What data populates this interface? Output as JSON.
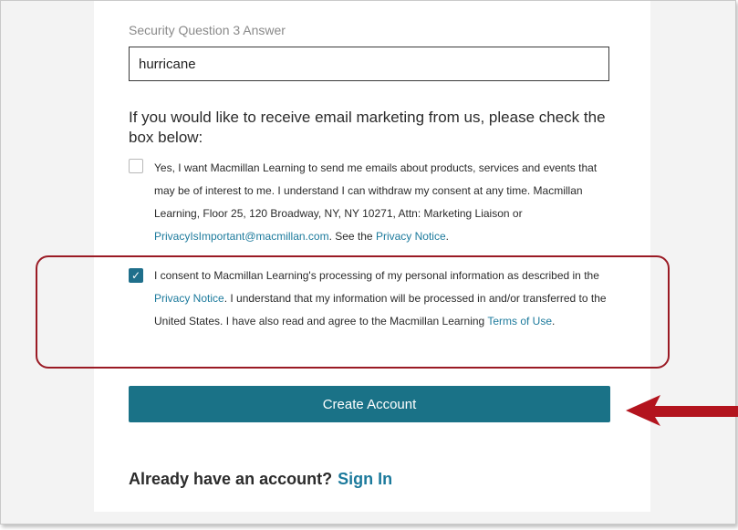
{
  "security": {
    "label": "Security Question 3 Answer",
    "answer_value": "hurricane"
  },
  "marketing": {
    "heading": "If you would like to receive email marketing from us, please check the box below:",
    "checked": false,
    "text_before": "Yes, I want Macmillan Learning to send me emails about products, services and events that may be of interest to me. I understand I can withdraw my consent at any time. Macmillan Learning, Floor 25, 120 Broadway, NY, NY 10271, Attn: Marketing Liaison or ",
    "email_link": "PrivacyIsImportant@macmillan.com",
    "text_mid": ". See the ",
    "privacy_link": "Privacy Notice",
    "text_end": "."
  },
  "consent": {
    "checked": true,
    "check_glyph": "✓",
    "text_before": "I consent to Macmillan Learning's processing of my personal information as described in the ",
    "privacy_link": "Privacy Notice",
    "text_mid": ". I understand that my information will be processed in and/or transferred to the United States. I have also read and agree to the Macmillan Learning ",
    "terms_link": "Terms of Use",
    "text_end": "."
  },
  "create_button_label": "Create Account",
  "signin": {
    "prompt": "Already have an account?",
    "link": "Sign In"
  },
  "colors": {
    "button": "#1a7287",
    "link": "#1c7a9c",
    "highlight": "#9a1a24",
    "arrow": "#b3141e"
  },
  "icons": {
    "arrow": "left-arrow-icon",
    "checkbox_checked": "checkmark-icon"
  }
}
